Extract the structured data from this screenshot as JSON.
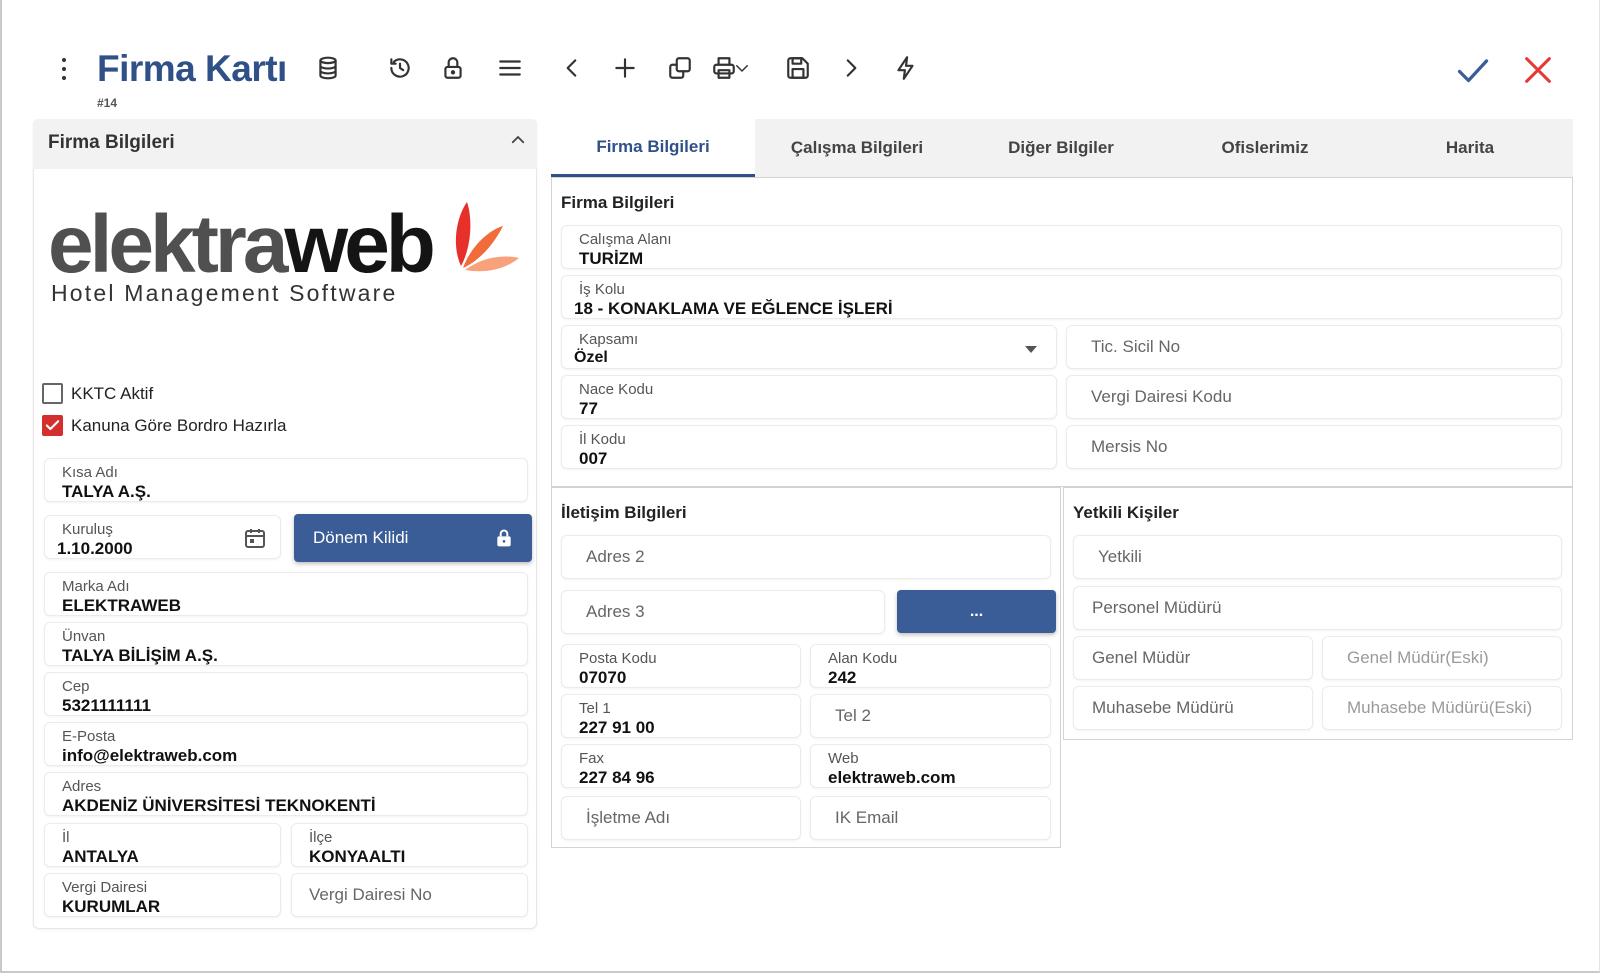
{
  "header": {
    "title": "Firma Kartı",
    "record_id": "#14"
  },
  "toolbar": {
    "icons": [
      "more-vert-icon",
      "database-icon",
      "history-icon",
      "lock-icon",
      "menu-icon",
      "chevron-left-icon",
      "plus-icon",
      "copy-icon",
      "print-icon",
      "chevron-down-icon",
      "save-icon",
      "chevron-right-icon",
      "flash-icon",
      "check-icon",
      "close-icon"
    ]
  },
  "left_panel": {
    "title": "Firma Bilgileri",
    "logo": {
      "word_part1": "elektra",
      "word_part2": "web",
      "tagline": "Hotel Management Software"
    },
    "checkboxes": [
      {
        "label": "KKTC Aktif",
        "checked": false
      },
      {
        "label": "Kanuna Göre Bordro Hazırla",
        "checked": true
      }
    ],
    "fields": {
      "kisa_adi": {
        "label": "Kısa Adı",
        "value": "TALYA A.Ş."
      },
      "kurulus": {
        "label": "Kuruluş",
        "value": "1.10.2000"
      },
      "marka_adi": {
        "label": "Marka Adı",
        "value": "ELEKTRAWEB"
      },
      "unvan": {
        "label": "Ünvan",
        "value": "TALYA BİLİŞİM A.Ş."
      },
      "cep": {
        "label": "Cep",
        "value": "5321111111"
      },
      "eposta": {
        "label": "E-Posta",
        "value": "info@elektraweb.com"
      },
      "adres": {
        "label": "Adres",
        "value": "AKDENİZ ÜNİVERSİTESİ TEKNOKENTİ"
      },
      "il": {
        "label": "İl",
        "value": "ANTALYA"
      },
      "ilce": {
        "label": "İlçe",
        "value": "KONYAALTI"
      },
      "vergi_dairesi": {
        "label": "Vergi Dairesi",
        "value": "KURUMLAR"
      },
      "vergi_dairesi_no": {
        "placeholder": "Vergi Dairesi No"
      }
    },
    "donem_button": "Dönem Kilidi"
  },
  "tabs": [
    {
      "label": "Firma Bilgileri",
      "active": true
    },
    {
      "label": "Çalışma Bilgileri",
      "active": false
    },
    {
      "label": "Diğer Bilgiler",
      "active": false
    },
    {
      "label": "Ofislerimiz",
      "active": false
    },
    {
      "label": "Harita",
      "active": false
    }
  ],
  "firma_section": {
    "title": "Firma Bilgileri",
    "calisma_alani": {
      "label": "Calışma Alanı",
      "value": "TURİZM"
    },
    "is_kolu": {
      "label": "İş Kolu",
      "value": "18 - KONAKLAMA VE EĞLENCE İŞLERİ"
    },
    "kapsami": {
      "label": "Kapsamı",
      "value": "Özel"
    },
    "tic_sicil_no": {
      "placeholder": "Tic. Sicil No"
    },
    "nace_kodu": {
      "label": "Nace Kodu",
      "value": "77"
    },
    "vergi_dairesi_kodu": {
      "placeholder": "Vergi Dairesi Kodu"
    },
    "il_kodu": {
      "label": "İl Kodu",
      "value": "007"
    },
    "mersis_no": {
      "placeholder": "Mersis No"
    }
  },
  "iletisim_section": {
    "title": "İletişim Bilgileri",
    "adres2": {
      "placeholder": "Adres 2"
    },
    "adres3": {
      "placeholder": "Adres 3"
    },
    "more_button": "...",
    "posta_kodu": {
      "label": "Posta Kodu",
      "value": "07070"
    },
    "alan_kodu": {
      "label": "Alan Kodu",
      "value": "242"
    },
    "tel1": {
      "label": "Tel 1",
      "value": "227 91 00"
    },
    "tel2": {
      "placeholder": "Tel 2"
    },
    "fax": {
      "label": "Fax",
      "value": "227 84 96"
    },
    "web": {
      "label": "Web",
      "value": "elektraweb.com"
    },
    "isletme_adi": {
      "placeholder": "İşletme Adı"
    },
    "ik_email": {
      "placeholder": "IK Email"
    }
  },
  "yetkili_section": {
    "title": "Yetkili Kişiler",
    "yetkili": {
      "placeholder": "Yetkili"
    },
    "personel_muduru": {
      "placeholder": "Personel Müdürü"
    },
    "genel_mudur": {
      "placeholder": "Genel Müdür"
    },
    "genel_mudur_eski": {
      "placeholder": "Genel Müdür(Eski)"
    },
    "muhasebe_muduru": {
      "placeholder": "Muhasebe Müdürü"
    },
    "muhasebe_muduru_eski": {
      "placeholder": "Muhasebe Müdürü(Eski)"
    }
  },
  "colors": {
    "brand_blue": "#2f5188",
    "button_blue": "#3a5d97",
    "check_red": "#d32f2f",
    "confirm_blue": "#3a5d97",
    "cancel_red": "#e53935",
    "logo_orange": "#e8462a"
  }
}
